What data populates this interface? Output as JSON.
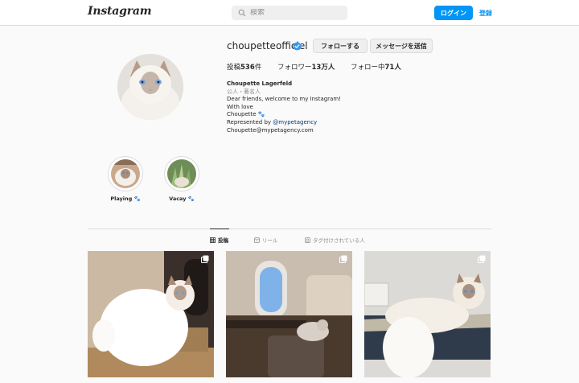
{
  "header": {
    "logo": "Instagram",
    "search_placeholder": "検索",
    "login_label": "ログイン",
    "signup_label": "登録"
  },
  "profile": {
    "username": "choupetteofficiel",
    "verified": true,
    "follow_label": "フォローする",
    "message_label": "メッセージを送信",
    "stats": {
      "posts_prefix": "投稿",
      "posts_value": "536",
      "posts_suffix": "件",
      "followers_prefix": "フォロワー",
      "followers_value": "13万人",
      "following_prefix": "フォロー中",
      "following_value": "71人"
    },
    "bio": {
      "name": "Choupette Lagerfeld",
      "category": "公人・著名人",
      "line1": "Dear friends, welcome to my Instagram!",
      "line2": "With love",
      "line3": "Choupette 🐾",
      "represented_prefix": "Represented by ",
      "mention": "@mypetagency",
      "email": "Choupette@mypetagency.com"
    }
  },
  "highlights": [
    {
      "label": "Playing 🐾"
    },
    {
      "label": "Vacay 🐾"
    }
  ],
  "tabs": [
    {
      "label": "投稿",
      "icon": "grid-icon",
      "active": true
    },
    {
      "label": "リール",
      "icon": "reels-icon",
      "active": false
    },
    {
      "label": "タグ付けされている人",
      "icon": "tagged-icon",
      "active": false
    }
  ],
  "colors": {
    "accent": "#0095f6",
    "verified": "#3897f0",
    "border": "#dbdbdb",
    "background": "#fafafa"
  }
}
